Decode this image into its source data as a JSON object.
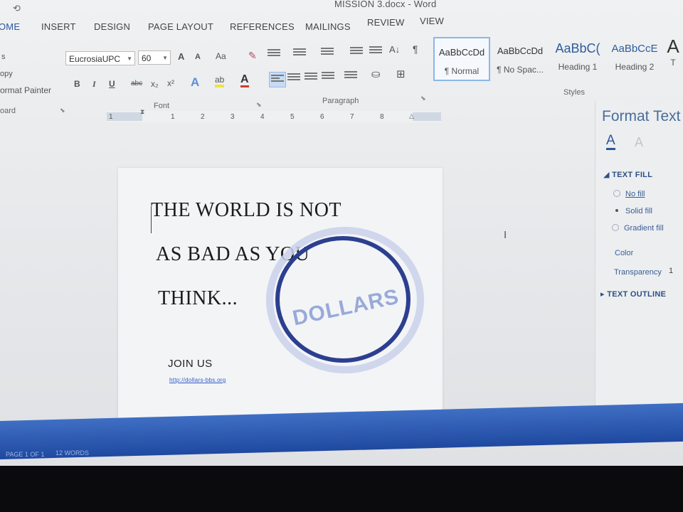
{
  "window": {
    "title": "MISSION 3.docx - Word"
  },
  "tabs": [
    {
      "label": "OME",
      "active": true
    },
    {
      "label": "INSERT"
    },
    {
      "label": "DESIGN"
    },
    {
      "label": "PAGE LAYOUT"
    },
    {
      "label": "REFERENCES"
    },
    {
      "label": "MAILINGS"
    },
    {
      "label": "REVIEW"
    },
    {
      "label": "VIEW"
    }
  ],
  "clipboard": {
    "copy": "opy",
    "format_painter": "ormat Painter",
    "group_label": "oard"
  },
  "font": {
    "name": "EucrosiaUPC",
    "size": "60",
    "group_label": "Font",
    "grow": "A",
    "shrink": "A",
    "case": "Aa",
    "bold": "B",
    "italic": "I",
    "underline": "U",
    "strike": "abc",
    "subscript": "x₂",
    "superscript": "x²",
    "effects": "A",
    "highlight": "ab",
    "font_color": "A"
  },
  "paragraph": {
    "group_label": "Paragraph",
    "sort": "A↓",
    "pilcrow": "¶"
  },
  "styles": {
    "group_label": "Styles",
    "items": [
      {
        "preview": "AaBbCcDd",
        "name": "¶ Normal"
      },
      {
        "preview": "AaBbCcDd",
        "name": "¶ No Spac..."
      },
      {
        "preview": "AaBbC(",
        "name": "Heading 1"
      },
      {
        "preview": "AaBbCcE",
        "name": "Heading 2"
      },
      {
        "preview": "A",
        "name": "T"
      }
    ]
  },
  "ruler": {
    "numbers": [
      "1",
      "1",
      "2",
      "3",
      "4",
      "5",
      "6",
      "7",
      "8"
    ]
  },
  "document": {
    "lines": [
      "THE WORLD IS NOT",
      "AS BAD AS YOU",
      "THINK..."
    ],
    "stamp_text": "DOLLARS",
    "join": "JOIN US",
    "link": "http://dollars-bbs.org"
  },
  "format_pane": {
    "title": "Format Text",
    "text_fill_label": "TEXT FILL",
    "options": [
      {
        "label": "No fill",
        "selected": false
      },
      {
        "label": "Solid fill",
        "selected": true
      },
      {
        "label": "Gradient fill",
        "selected": false
      }
    ],
    "color_label": "Color",
    "transparency_label": "Transparency",
    "transparency_value": "1",
    "text_outline_label": "TEXT OUTLINE"
  },
  "statusbar": {
    "page": "PAGE 1 OF 1",
    "words": "12 WORDS"
  },
  "colors": {
    "accent": "#2b579a",
    "stamp": "#2c3f8f",
    "statusbar": "#2b56b0"
  }
}
